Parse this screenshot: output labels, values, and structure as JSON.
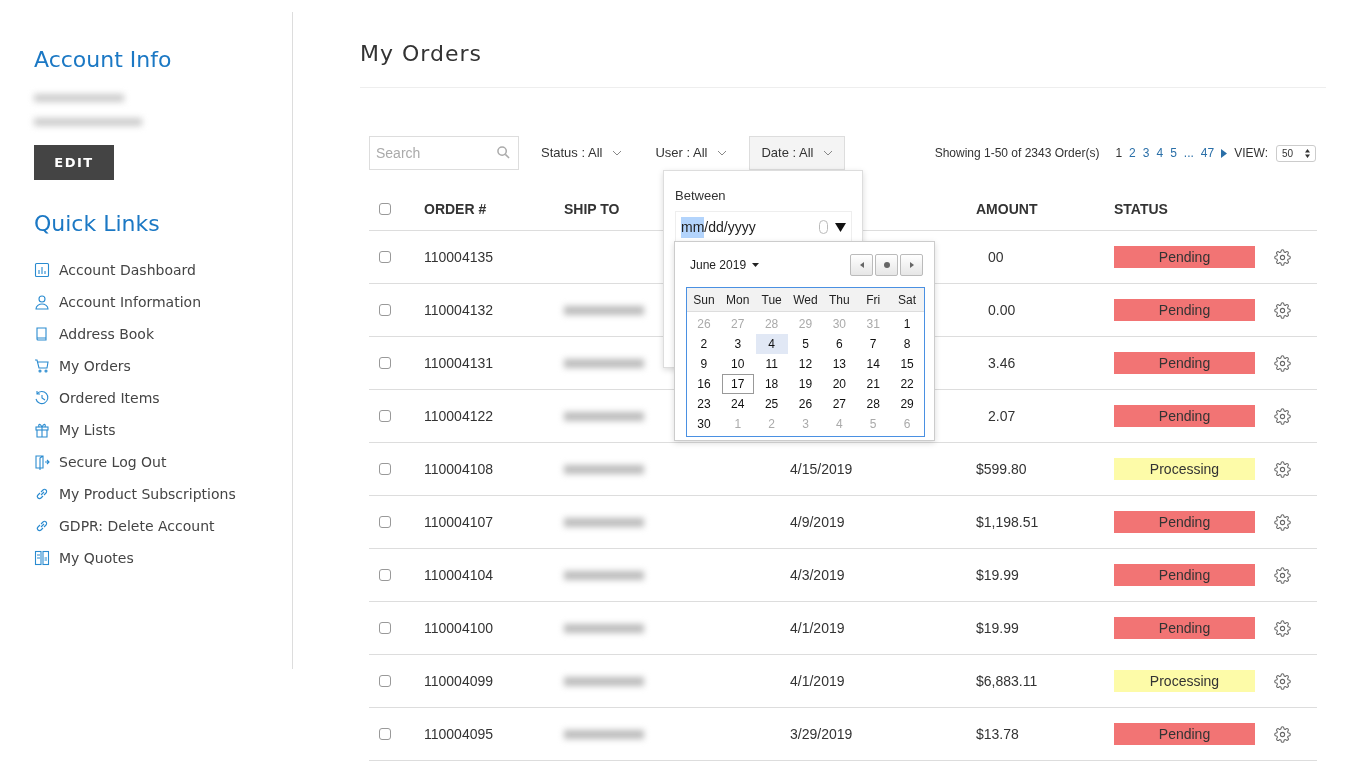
{
  "sidebar": {
    "account_title": "Account Info",
    "edit_button": "EDIT",
    "links_title": "Quick Links",
    "links": [
      {
        "kind": "chart",
        "label": "Account Dashboard"
      },
      {
        "kind": "user",
        "label": "Account Information"
      },
      {
        "kind": "book",
        "label": "Address Book"
      },
      {
        "kind": "cart",
        "label": "My Orders"
      },
      {
        "kind": "history",
        "label": "Ordered Items"
      },
      {
        "kind": "gift",
        "label": "My Lists"
      },
      {
        "kind": "logout",
        "label": "Secure Log Out"
      },
      {
        "kind": "link",
        "label": "My Product Subscriptions"
      },
      {
        "kind": "link",
        "label": "GDPR: Delete Account"
      },
      {
        "kind": "quotes",
        "label": "My Quotes"
      }
    ]
  },
  "page_title": "My Orders",
  "toolbar": {
    "search_placeholder": "Search",
    "filters": [
      {
        "label": "Status : All",
        "open": false
      },
      {
        "label": "User : All",
        "open": false
      },
      {
        "label": "Date : All",
        "open": true
      }
    ],
    "showing": "Showing 1-50 of 2343 Order(s)",
    "pages": [
      {
        "label": "1",
        "selected": true
      },
      {
        "label": "2",
        "selected": false
      },
      {
        "label": "3",
        "selected": false
      },
      {
        "label": "4",
        "selected": false
      },
      {
        "label": "5",
        "selected": false
      },
      {
        "label": "...",
        "selected": false
      },
      {
        "label": "47",
        "selected": false
      }
    ],
    "view_label": "VIEW:",
    "view_value": "50"
  },
  "table": {
    "select_all_checked": false,
    "columns": [
      "ORDER #",
      "SHIP TO",
      "AMOUNT",
      "STATUS"
    ],
    "rows": [
      {
        "order": "110004135",
        "checked": false,
        "ship_blurred": false,
        "amount": "00",
        "status": "Pending",
        "color": "#f27474"
      },
      {
        "order": "110004132",
        "checked": false,
        "ship_blurred": true,
        "amount": "0.00",
        "status": "Pending",
        "color": "#f27474"
      },
      {
        "order": "110004131",
        "checked": false,
        "ship_blurred": true,
        "amount": "3.46",
        "status": "Pending",
        "color": "#f27474"
      },
      {
        "order": "110004122",
        "checked": false,
        "ship_blurred": true,
        "amount": "2.07",
        "status": "Pending",
        "color": "#f27474"
      },
      {
        "order": "110004108",
        "checked": false,
        "ship_blurred": true,
        "date": "4/15/2019",
        "amount": "$599.80",
        "status": "Processing",
        "color": "#fdfba8"
      },
      {
        "order": "110004107",
        "checked": false,
        "ship_blurred": true,
        "date": "4/9/2019",
        "amount": "$1,198.51",
        "status": "Pending",
        "color": "#f27474"
      },
      {
        "order": "110004104",
        "checked": false,
        "ship_blurred": true,
        "date": "4/3/2019",
        "amount": "$19.99",
        "status": "Pending",
        "color": "#f27474"
      },
      {
        "order": "110004100",
        "checked": false,
        "ship_blurred": true,
        "date": "4/1/2019",
        "amount": "$19.99",
        "status": "Pending",
        "color": "#f27474"
      },
      {
        "order": "110004099",
        "checked": false,
        "ship_blurred": true,
        "date": "4/1/2019",
        "amount": "$6,883.11",
        "status": "Processing",
        "color": "#fdfba8"
      },
      {
        "order": "110004095",
        "checked": false,
        "ship_blurred": true,
        "date": "3/29/2019",
        "amount": "$13.78",
        "status": "Pending",
        "color": "#f27474"
      }
    ]
  },
  "date_popover": {
    "label": "Between",
    "field_segments": [
      {
        "text": "mm",
        "selected": true
      },
      {
        "text": "/dd/yyyy",
        "selected": false
      }
    ],
    "calendar": {
      "month": "June 2019",
      "weekdays": [
        "Sun",
        "Mon",
        "Tue",
        "Wed",
        "Thu",
        "Fri",
        "Sat"
      ],
      "weeks": [
        [
          {
            "d": "26",
            "outside": true,
            "hovered": false,
            "today": false
          },
          {
            "d": "27",
            "outside": true,
            "hovered": false,
            "today": false
          },
          {
            "d": "28",
            "outside": true,
            "hovered": false,
            "today": false
          },
          {
            "d": "29",
            "outside": true,
            "hovered": false,
            "today": false
          },
          {
            "d": "30",
            "outside": true,
            "hovered": false,
            "today": false
          },
          {
            "d": "31",
            "outside": true,
            "hovered": false,
            "today": false
          },
          {
            "d": "1",
            "outside": false,
            "hovered": false,
            "today": false
          }
        ],
        [
          {
            "d": "2",
            "outside": false,
            "hovered": false,
            "today": false
          },
          {
            "d": "3",
            "outside": false,
            "hovered": false,
            "today": false
          },
          {
            "d": "4",
            "outside": false,
            "hovered": true,
            "today": false
          },
          {
            "d": "5",
            "outside": false,
            "hovered": false,
            "today": false
          },
          {
            "d": "6",
            "outside": false,
            "hovered": false,
            "today": false
          },
          {
            "d": "7",
            "outside": false,
            "hovered": false,
            "today": false
          },
          {
            "d": "8",
            "outside": false,
            "hovered": false,
            "today": false
          }
        ],
        [
          {
            "d": "9",
            "outside": false,
            "hovered": false,
            "today": false
          },
          {
            "d": "10",
            "outside": false,
            "hovered": false,
            "today": false
          },
          {
            "d": "11",
            "outside": false,
            "hovered": false,
            "today": false
          },
          {
            "d": "12",
            "outside": false,
            "hovered": false,
            "today": false
          },
          {
            "d": "13",
            "outside": false,
            "hovered": false,
            "today": false
          },
          {
            "d": "14",
            "outside": false,
            "hovered": false,
            "today": false
          },
          {
            "d": "15",
            "outside": false,
            "hovered": false,
            "today": false
          }
        ],
        [
          {
            "d": "16",
            "outside": false,
            "hovered": false,
            "today": false
          },
          {
            "d": "17",
            "outside": false,
            "hovered": false,
            "today": true
          },
          {
            "d": "18",
            "outside": false,
            "hovered": false,
            "today": false
          },
          {
            "d": "19",
            "outside": false,
            "hovered": false,
            "today": false
          },
          {
            "d": "20",
            "outside": false,
            "hovered": false,
            "today": false
          },
          {
            "d": "21",
            "outside": false,
            "hovered": false,
            "today": false
          },
          {
            "d": "22",
            "outside": false,
            "hovered": false,
            "today": false
          }
        ],
        [
          {
            "d": "23",
            "outside": false,
            "hovered": false,
            "today": false
          },
          {
            "d": "24",
            "outside": false,
            "hovered": false,
            "today": false
          },
          {
            "d": "25",
            "outside": false,
            "hovered": false,
            "today": false
          },
          {
            "d": "26",
            "outside": false,
            "hovered": false,
            "today": false
          },
          {
            "d": "27",
            "outside": false,
            "hovered": false,
            "today": false
          },
          {
            "d": "28",
            "outside": false,
            "hovered": false,
            "today": false
          },
          {
            "d": "29",
            "outside": false,
            "hovered": false,
            "today": false
          }
        ],
        [
          {
            "d": "30",
            "outside": false,
            "hovered": false,
            "today": false
          },
          {
            "d": "1",
            "outside": true,
            "hovered": false,
            "today": false
          },
          {
            "d": "2",
            "outside": true,
            "hovered": false,
            "today": false
          },
          {
            "d": "3",
            "outside": true,
            "hovered": false,
            "today": false
          },
          {
            "d": "4",
            "outside": true,
            "hovered": false,
            "today": false
          },
          {
            "d": "5",
            "outside": true,
            "hovered": false,
            "today": false
          },
          {
            "d": "6",
            "outside": true,
            "hovered": false,
            "today": false
          }
        ]
      ]
    }
  }
}
